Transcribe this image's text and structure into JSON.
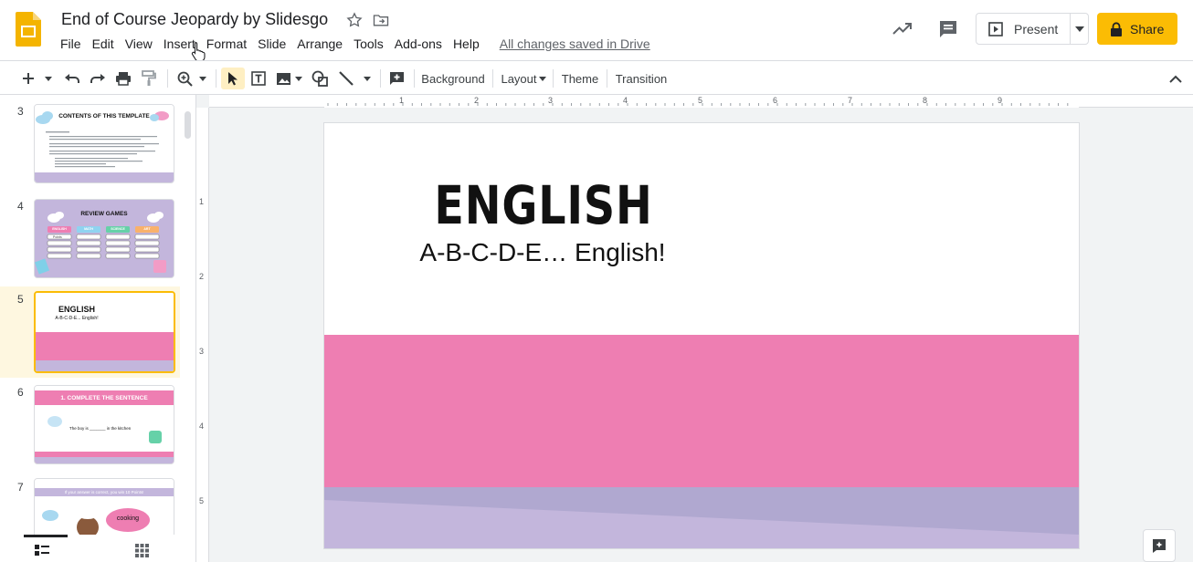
{
  "app": {
    "doc_title": "End of Course Jeopardy by Slidesgo",
    "menu": [
      "File",
      "Edit",
      "View",
      "Insert",
      "Format",
      "Slide",
      "Arrange",
      "Tools",
      "Add-ons",
      "Help"
    ],
    "saved_status": "All changes saved in Drive",
    "present_label": "Present",
    "share_label": "Share",
    "accent_color": "#fbbc04"
  },
  "toolbar": {
    "background_label": "Background",
    "layout_label": "Layout",
    "theme_label": "Theme",
    "transition_label": "Transition"
  },
  "filmstrip": {
    "slides": [
      {
        "num": "3",
        "title": "CONTENTS OF THIS TEMPLATE"
      },
      {
        "num": "4",
        "title": "REVIEW GAMES",
        "columns": [
          "ENGLISH",
          "MATH",
          "SCIENCE",
          "ART"
        ],
        "cell": "Points"
      },
      {
        "num": "5",
        "title": "ENGLISH",
        "subtitle": "A-B-C-D-E... English!"
      },
      {
        "num": "6",
        "title": "1. COMPLETE THE SENTENCE",
        "body": "The boy is _______ in the kitchen"
      },
      {
        "num": "7",
        "title": "If your answer is correct, you win 10 Points!",
        "bubble": "cooking"
      }
    ],
    "selected": "5"
  },
  "ruler": {
    "h": [
      "1",
      "2",
      "3",
      "4",
      "5",
      "6",
      "7",
      "8",
      "9"
    ],
    "v": [
      "1",
      "2",
      "3",
      "4",
      "5"
    ]
  },
  "slide": {
    "title": "ENGLISH",
    "subtitle": "A-B-C-D-E… English!",
    "pink": "#ee7eb2",
    "lavender": "#c3b6dc"
  }
}
